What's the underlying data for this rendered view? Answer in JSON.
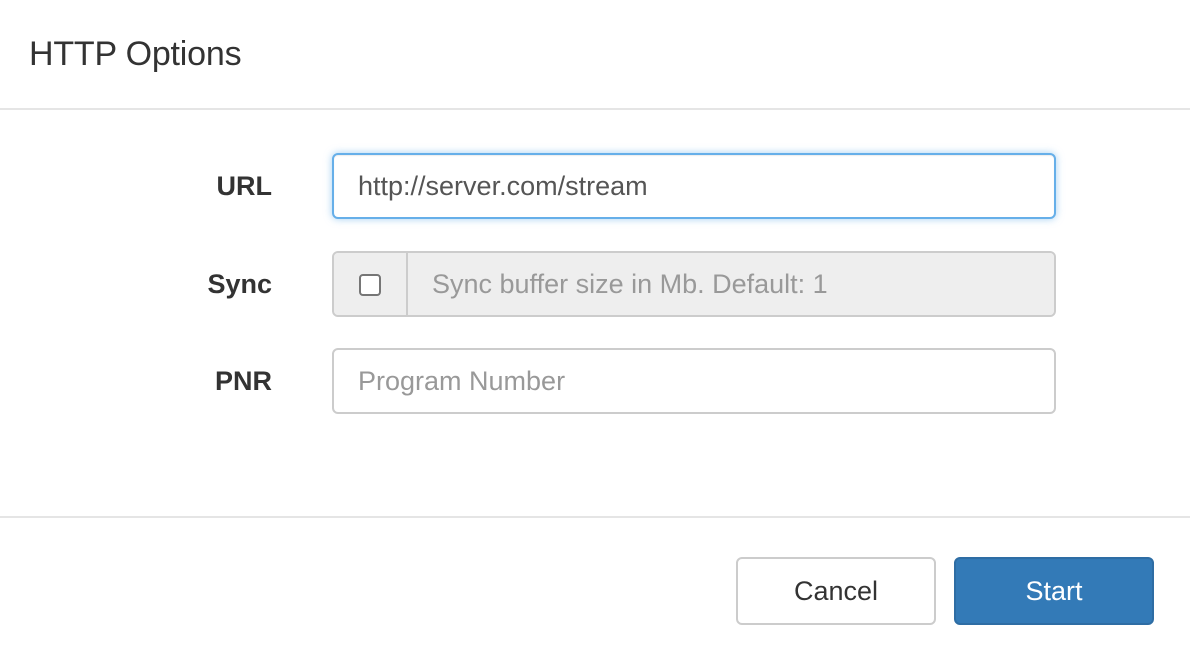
{
  "header": {
    "title": "HTTP Options"
  },
  "form": {
    "url": {
      "label": "URL",
      "value": "http://server.com/stream",
      "placeholder": ""
    },
    "sync": {
      "label": "Sync",
      "checked": false,
      "placeholder": "Sync buffer size in Mb. Default: 1"
    },
    "pnr": {
      "label": "PNR",
      "value": "",
      "placeholder": "Program Number"
    }
  },
  "footer": {
    "cancel_label": "Cancel",
    "start_label": "Start"
  },
  "colors": {
    "primary": "#337ab7",
    "primary_border": "#2e6da4",
    "focus_border": "#66afe9",
    "disabled_background": "#eeeeee",
    "border": "#cccccc"
  }
}
